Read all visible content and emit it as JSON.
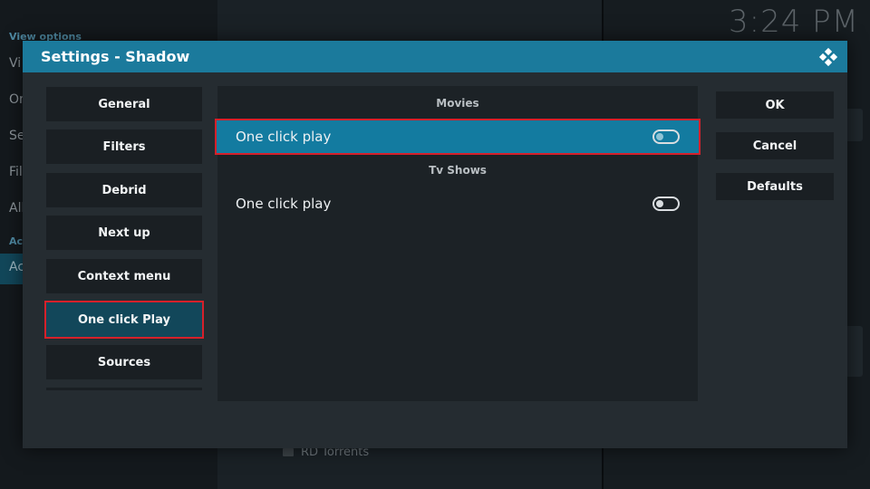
{
  "background": {
    "left_menu": {
      "header_view": "View options",
      "items": [
        "Vi",
        "On",
        "Se",
        "Fil",
        "All"
      ],
      "header_actions": "Ac",
      "active_item": "Ac"
    },
    "list_item": "RD Torrents",
    "clock": "3:24 PM"
  },
  "dialog": {
    "title": "Settings - Shadow",
    "categories": [
      {
        "label": "General"
      },
      {
        "label": "Filters"
      },
      {
        "label": "Debrid"
      },
      {
        "label": "Next up"
      },
      {
        "label": "Context menu"
      },
      {
        "label": "One click Play",
        "selected": true
      },
      {
        "label": "Sources"
      }
    ],
    "sections": [
      {
        "header": "Movies",
        "settings": [
          {
            "label": "One click play",
            "type": "toggle",
            "enabled": false,
            "focused": true
          }
        ]
      },
      {
        "header": "Tv Shows",
        "settings": [
          {
            "label": "One click play",
            "type": "toggle",
            "enabled": false,
            "focused": false
          }
        ]
      }
    ],
    "buttons": {
      "ok": "OK",
      "cancel": "Cancel",
      "defaults": "Defaults"
    }
  },
  "colors": {
    "accent": "#1b7a9c",
    "focus_row": "#137ba0",
    "selected_category": "#12475a",
    "highlight_border": "#d6202a"
  },
  "icons": {
    "logo": "kodi-logo-icon",
    "list_item": "folder-icon"
  }
}
